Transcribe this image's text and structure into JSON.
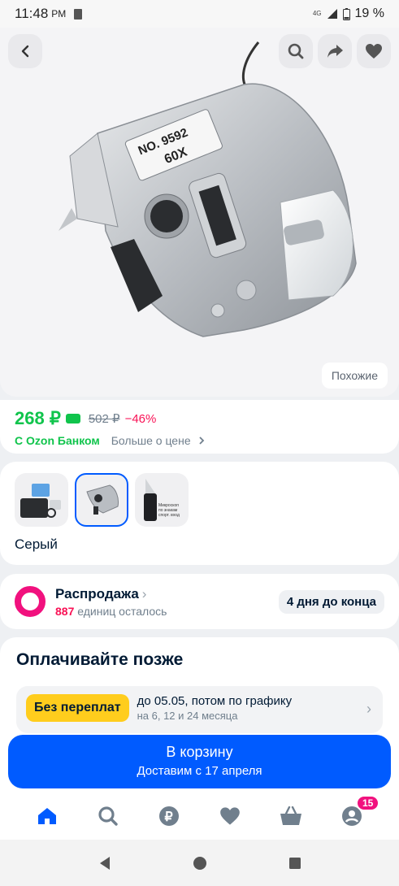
{
  "status_bar": {
    "time": "11:48",
    "ampm": "PM",
    "network": "4G",
    "battery": "19 %"
  },
  "hero": {
    "similar_label": "Похожие",
    "product_text_line1": "NO. 9592",
    "product_text_line2": "60X"
  },
  "price": {
    "current": "268 ₽",
    "old": "502 ₽",
    "discount": "−46%",
    "bank_label": "С Ozon Банком",
    "more_label": "Больше о цене"
  },
  "variants": {
    "selected_color": "Серый",
    "thumb_text": "Микроскоп по знакам спорт. вход"
  },
  "sale": {
    "title": "Распродажа",
    "count": "887",
    "remaining_label": "единиц осталось",
    "days_left": "4 дня до конца"
  },
  "pay_later": {
    "title": "Оплачивайте позже",
    "badge": "Без переплат",
    "line1": "до 05.05, потом по графику",
    "line2": "на 6, 12 и 24 месяца"
  },
  "cart": {
    "label": "В корзину",
    "delivery": "Доставим с 17 апреля"
  },
  "bottom_nav": {
    "cart_badge": "15"
  },
  "colors": {
    "accent": "#005bff",
    "green": "#10c44c",
    "pink": "#f1117e",
    "yellow": "#ffcd1d"
  }
}
